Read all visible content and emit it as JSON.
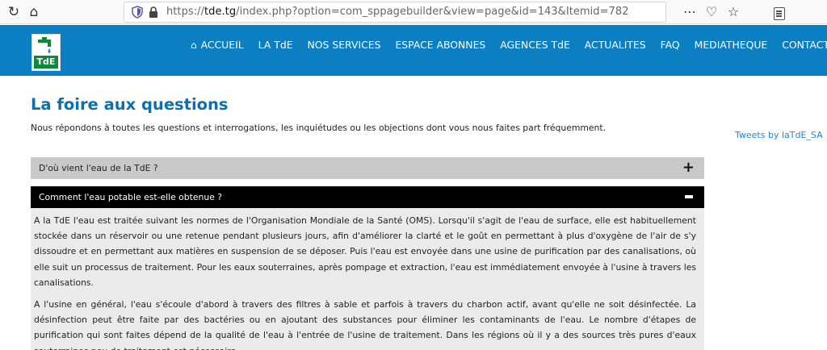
{
  "browser": {
    "url_prefix": "https://",
    "url_host": "tde.tg",
    "url_path": "/index.php?option=com_sppagebuilder&view=page&id=143&Itemid=782",
    "menu_glyph": "⋯",
    "pocket_glyph": "♡",
    "star_glyph": "☆",
    "reload_glyph": "↻",
    "home_glyph": "⌂"
  },
  "logo": {
    "text": "TdE"
  },
  "nav": {
    "home_glyph": "⌂",
    "items": [
      "ACCUEIL",
      "LA TdE",
      "NOS SERVICES",
      "ESPACE ABONNES",
      "AGENCES TdE",
      "ACTUALITES",
      "FAQ",
      "MEDIATHEQUE",
      "CONTACT"
    ]
  },
  "page": {
    "title": "La foire aux questions",
    "subtitle": "Nous répondons à toutes les questions et interrogations, les inquiétudes ou les objections dont vous nous faites part fréquemment.",
    "tweets_link": "Tweets by laTdE_SA"
  },
  "faq": {
    "items": [
      {
        "question": "D'où vient l'eau de la TdE ?",
        "toggle": "+"
      },
      {
        "question": "Comment l'eau potable est-elle obtenue ?",
        "toggle": "−"
      }
    ],
    "answer_paragraphs": [
      "A la TdE l'eau est traitée suivant les normes de l'Organisation Mondiale de la Santé (OMS). Lorsqu'il s'agit de l'eau de surface, elle est habituellement stockée dans un réservoir ou une retenue pendant plusieurs jours, afin d'améliorer la clarté et le goût en permettant à plus d'oxygène de l'air de s'y dissoudre et en permettant aux matières en suspension de se déposer. Puis l'eau est envoyée dans une usine de purification par des canalisations, où elle suit un processus de traitement. Pour les eaux souterraines, après pompage et extraction, l'eau est immédiatement envoyée à l'usine à travers les canalisations.",
      "A l'usine en général, l'eau s'écoule d'abord à travers des filtres à sable et parfois à travers du charbon actif, avant qu'elle ne soit désinfectée. La désinfection peut être faite par des bactéries ou en ajoutant des substances pour éliminer les contaminants de l'eau. Le nombre d'étapes de purification qui sont faites dépend de la qualité de l'eau à l'entrée de l'usine de traitement. Dans les régions où il y a des sources très pures d'eaux souterraines peu de traitement est nécessaire."
    ]
  },
  "colors": {
    "header_bg": "#0b7fc1",
    "title_blue": "#0b6fb0",
    "faq_collapsed_bg": "#c9c9c9",
    "faq_active_bg": "#000000",
    "faq_answer_bg": "#ebebeb",
    "logo_green": "#0b8a3a"
  }
}
